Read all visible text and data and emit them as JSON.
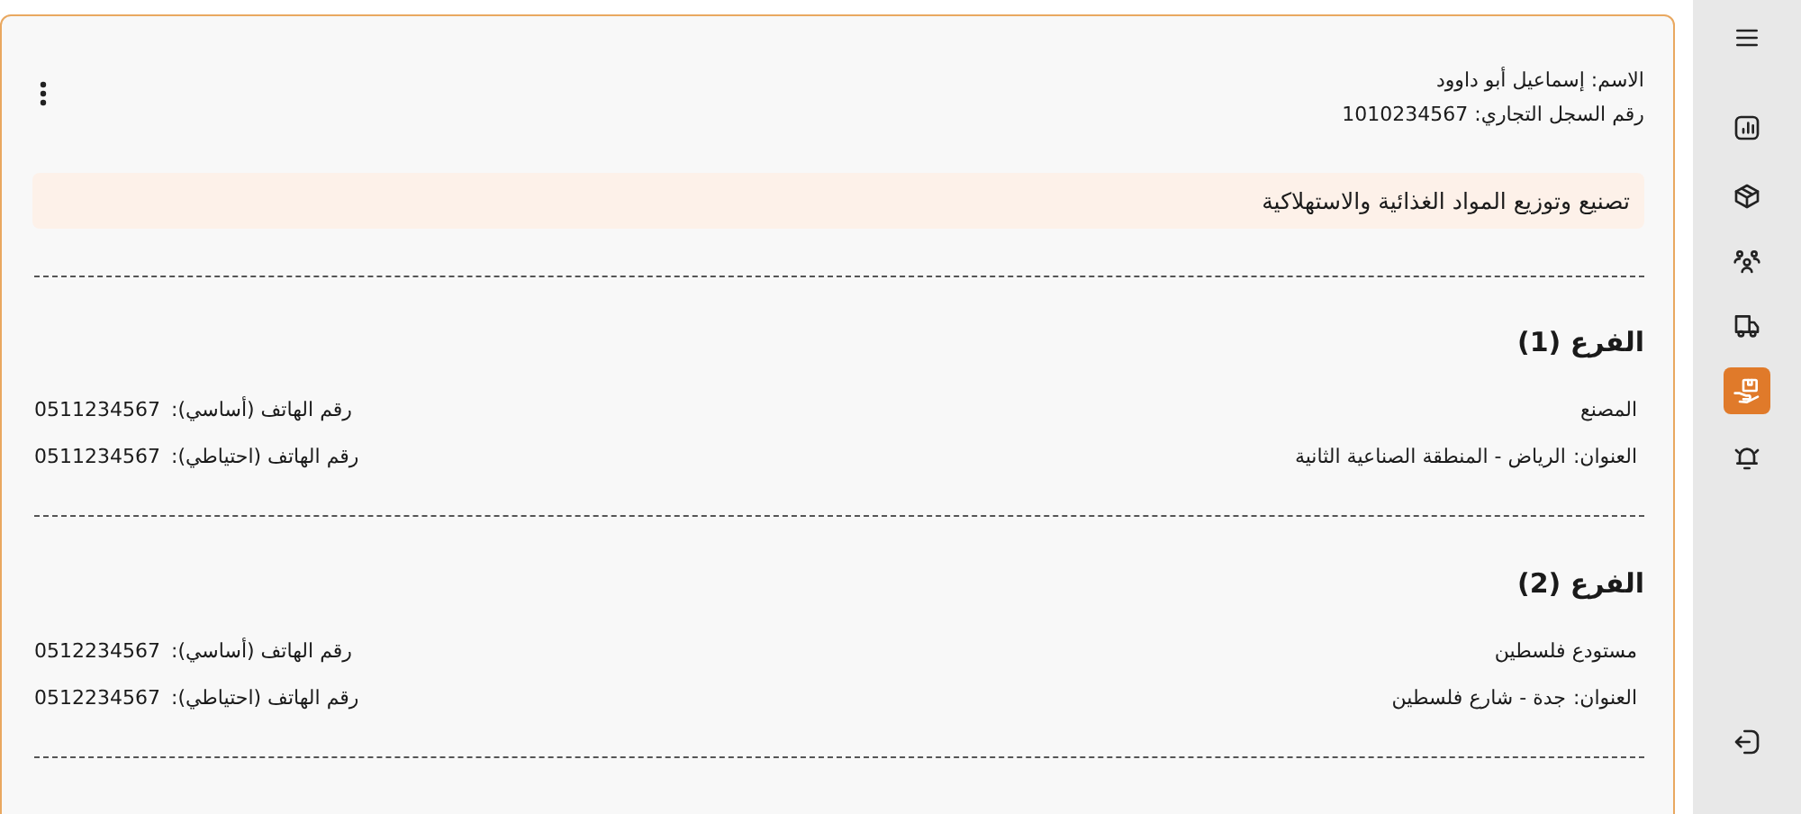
{
  "sidebar": {
    "items": [
      {
        "selected": false
      },
      {
        "selected": false
      },
      {
        "selected": false
      },
      {
        "selected": false
      },
      {
        "selected": false
      },
      {
        "selected": true
      },
      {
        "selected": false
      }
    ],
    "bottom_items": [
      {
        "selected": false
      }
    ]
  },
  "company": {
    "name_line": "الاسم: إسماعيل أبو داوود",
    "register_line": "رقم السجل التجاري: 1010234567",
    "activity": "تصنيع وتوزيع المواد الغذائية والاستهلاكية"
  },
  "branches": [
    {
      "title": "الفرع (1)",
      "name": "المصنع",
      "address_label": "العنوان:",
      "address": "الرياض - المنطقة الصناعية الثانية",
      "phone_primary_label": "رقم الهاتف (أساسي):",
      "phone_primary": "0511234567",
      "phone_backup_label": "رقم الهاتف (احتياطي):",
      "phone_backup": "0511234567"
    },
    {
      "title": "الفرع (2)",
      "name": "مستودع فلسطين",
      "address_label": "العنوان:",
      "address": "جدة - شارع فلسطين",
      "phone_primary_label": "رقم الهاتف (أساسي):",
      "phone_primary": "0512234567",
      "phone_backup_label": "رقم الهاتف (احتياطي):",
      "phone_backup": "0512234567"
    }
  ]
}
